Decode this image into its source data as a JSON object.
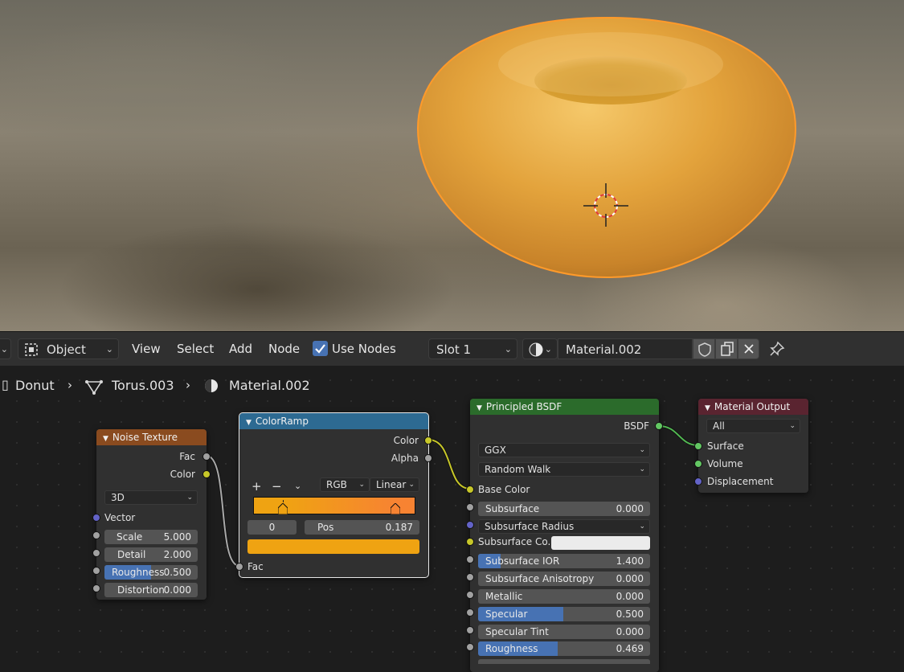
{
  "header": {
    "mode_label": "Object",
    "menus": [
      "View",
      "Select",
      "Add",
      "Node"
    ],
    "use_nodes_label": "Use Nodes",
    "use_nodes_checked": true,
    "slot_label": "Slot 1",
    "material_name": "Material.002"
  },
  "breadcrumb": {
    "object": "Donut",
    "mesh": "Torus.003",
    "material": "Material.002"
  },
  "nodes": {
    "noise": {
      "title": "Noise Texture",
      "out_fac": "Fac",
      "out_color": "Color",
      "dimensions": "3D",
      "in_vector": "Vector",
      "scale_label": "Scale",
      "scale_value": "5.000",
      "detail_label": "Detail",
      "detail_value": "2.000",
      "roughness_label": "Roughness",
      "roughness_value": "0.500",
      "distortion_label": "Distortion",
      "distortion_value": "0.000"
    },
    "colorramp": {
      "title": "ColorRamp",
      "out_color": "Color",
      "out_alpha": "Alpha",
      "add_symbol": "+",
      "remove_symbol": "−",
      "color_mode": "RGB",
      "interpolation": "Linear",
      "active_index": "0",
      "pos_label": "Pos",
      "pos_value": "0.187",
      "in_fac": "Fac",
      "stop_colors": [
        "#efa312",
        "#f78332"
      ]
    },
    "bsdf": {
      "title": "Principled BSDF",
      "out_bsdf": "BSDF",
      "distribution": "GGX",
      "subsurface_method": "Random Walk",
      "base_color_label": "Base Color",
      "subsurface_label": "Subsurface",
      "subsurface_value": "0.000",
      "subsurface_radius_label": "Subsurface Radius",
      "subsurface_color_label": "Subsurface Co...",
      "subsurface_ior_label": "Subsurface IOR",
      "subsurface_ior_value": "1.400",
      "subsurface_aniso_label": "Subsurface Anisotropy",
      "subsurface_aniso_value": "0.000",
      "metallic_label": "Metallic",
      "metallic_value": "0.000",
      "specular_label": "Specular",
      "specular_value": "0.500",
      "specular_tint_label": "Specular Tint",
      "specular_tint_value": "0.000",
      "roughness_label": "Roughness",
      "roughness_value": "0.469"
    },
    "output": {
      "title": "Material Output",
      "target": "All",
      "in_surface": "Surface",
      "in_volume": "Volume",
      "in_displacement": "Displacement"
    }
  },
  "colors": {
    "noise_header": "#8a4b1f",
    "colorramp_header": "#2d6a92",
    "bsdf_header": "#2b6b2b",
    "output_header": "#5a2430",
    "accent_blue": "#4772b3",
    "selection_orange": "#ff9a2a"
  }
}
